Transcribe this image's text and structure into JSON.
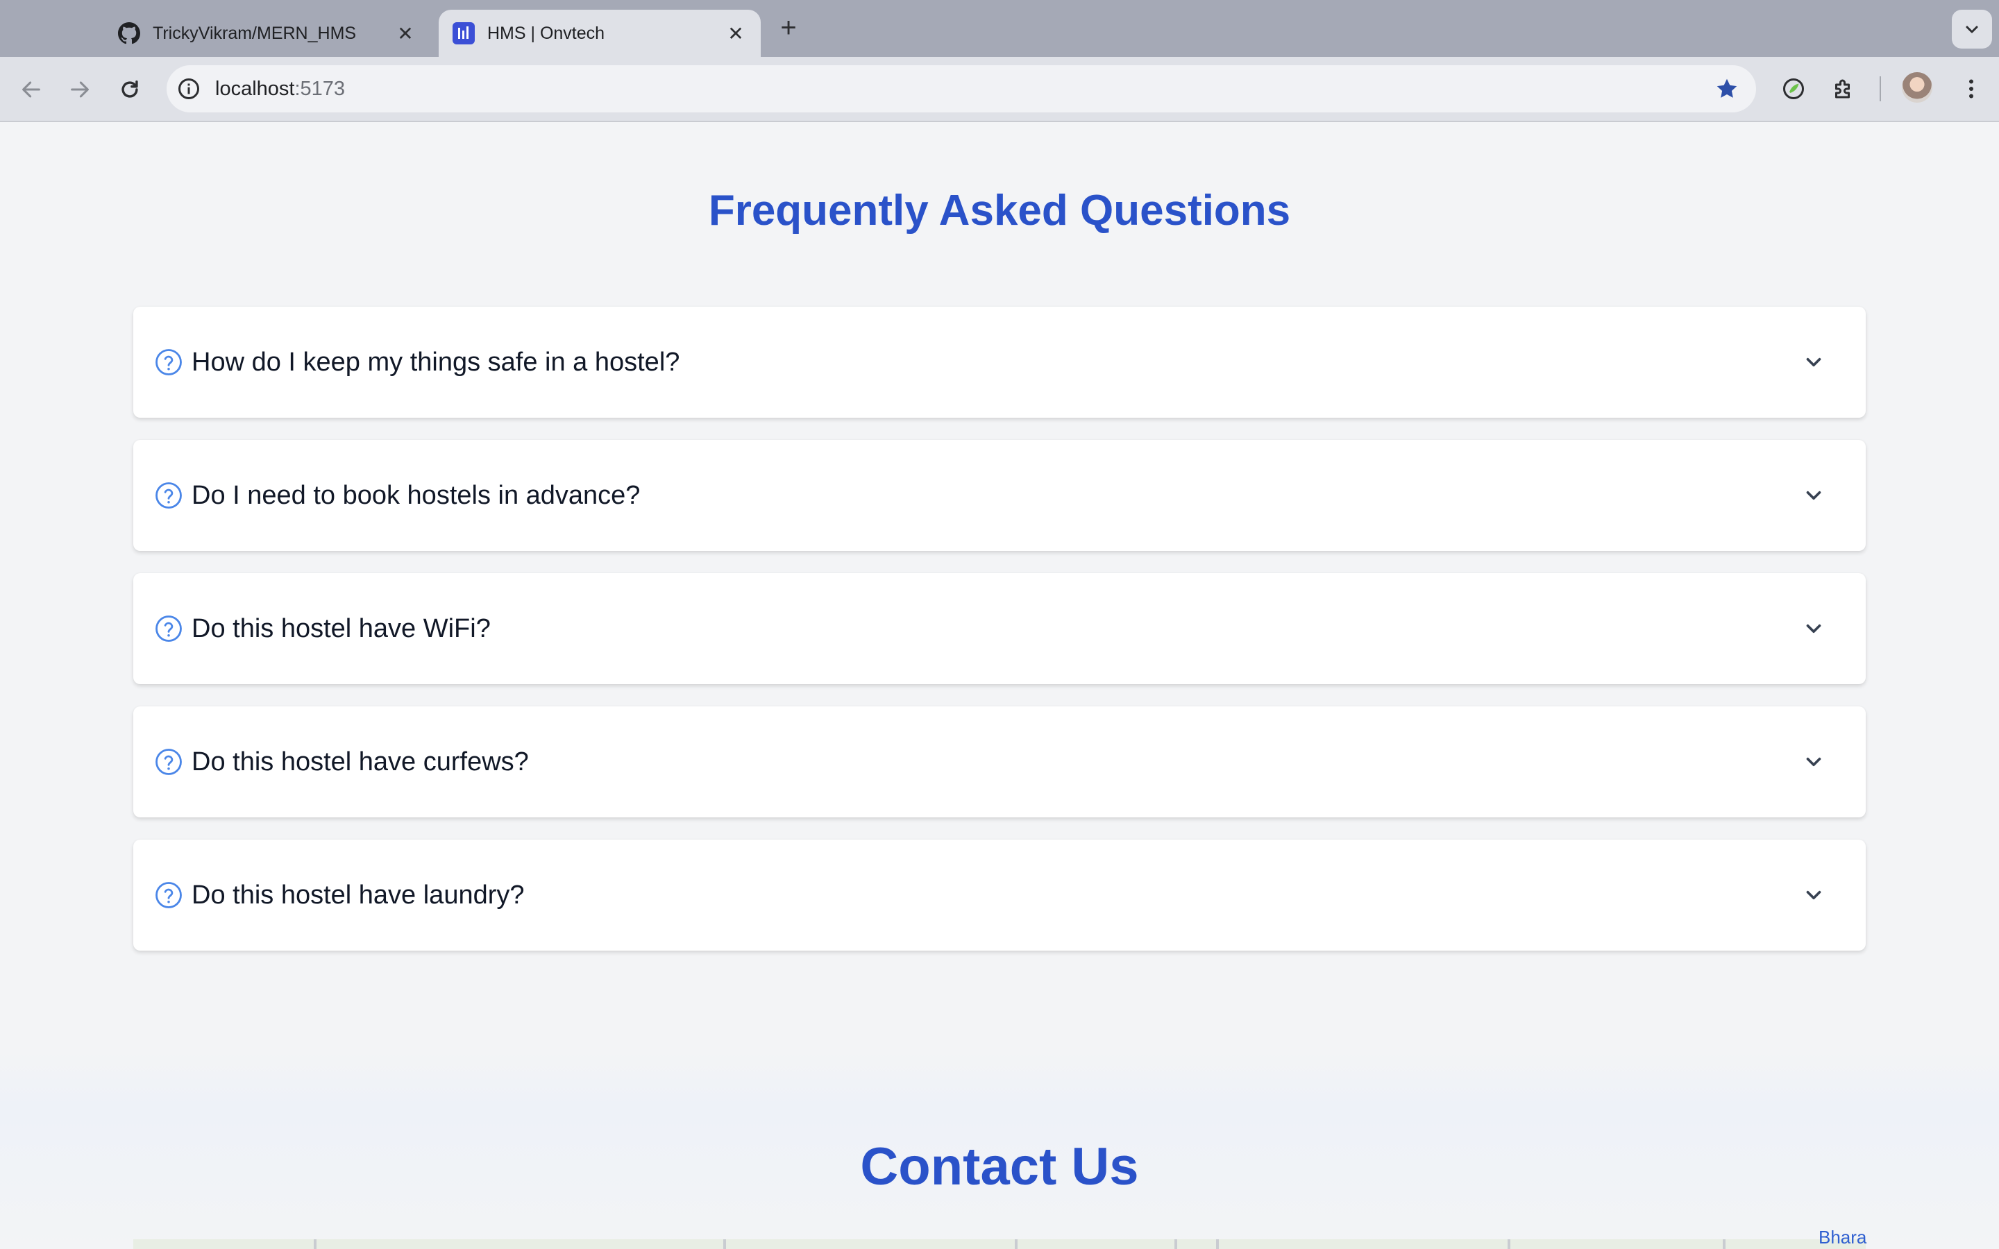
{
  "browser": {
    "tabs": [
      {
        "title": "TrickyVikram/MERN_HMS",
        "favicon": "github-icon",
        "active": false
      },
      {
        "title": "HMS | Onvtech",
        "favicon": "chart-bars-icon",
        "active": true
      }
    ],
    "url_host": "localhost",
    "url_port": ":5173"
  },
  "faq": {
    "title": "Frequently Asked Questions",
    "items": [
      {
        "question": "How do I keep my things safe in a hostel?"
      },
      {
        "question": "Do I need to book hostels in advance?"
      },
      {
        "question": "Do this hostel have WiFi?"
      },
      {
        "question": "Do this hostel have curfews?"
      },
      {
        "question": "Do this hostel have laundry?"
      }
    ]
  },
  "contact": {
    "title": "Contact Us",
    "map_label": "Bhara"
  },
  "colors": {
    "accent": "#2a52c9",
    "question_icon": "#4a86e8",
    "tabbar": "#a5a9b6",
    "toolbar": "#dfe1e7"
  }
}
